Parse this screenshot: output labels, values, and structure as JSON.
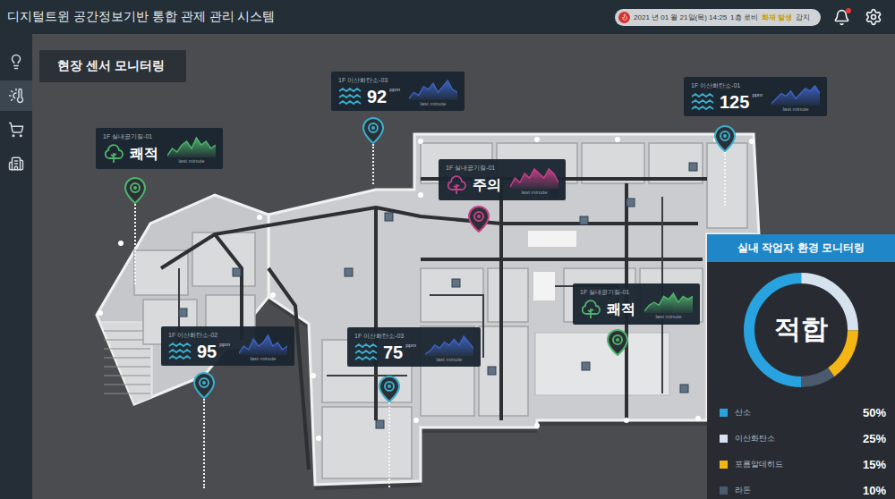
{
  "window": {
    "title": "디지털트윈 공간정보기반 통합 관제 관리 시스템"
  },
  "alert": {
    "date": "2021 년 01 월 21일(목) 14:25",
    "location": "1층 로비",
    "event": "화재 발생",
    "suffix": "감지"
  },
  "notifications": {
    "unread": true
  },
  "sidebar": {
    "items": [
      {
        "selected": false
      },
      {
        "selected": true
      },
      {
        "selected": false
      },
      {
        "selected": false
      }
    ]
  },
  "page": {
    "title": "현장 센서 모니터링"
  },
  "sensors": [
    {
      "kind": "air",
      "label": "1F 실내공기질-01",
      "status": "쾌적",
      "color": "#4fb36b",
      "caption": "last minute",
      "spark": [
        4,
        6,
        5,
        7,
        8,
        6,
        9,
        7,
        8,
        6,
        7
      ]
    },
    {
      "kind": "co2",
      "label": "1F 이산화탄소-03",
      "value": "92",
      "unit": "ppm",
      "color": "#3aaecb",
      "caption": "last minute",
      "spark": [
        3,
        5,
        4,
        7,
        6,
        8,
        5,
        7,
        9,
        6,
        5
      ]
    },
    {
      "kind": "co2",
      "label": "1F 이산화탄소-01",
      "value": "125",
      "unit": "ppm",
      "color": "#3aaecb",
      "caption": "last minute",
      "spark": [
        2,
        4,
        6,
        5,
        7,
        4,
        6,
        8,
        7,
        9,
        6
      ]
    },
    {
      "kind": "air",
      "label": "1F 실내공기질-01",
      "status": "주의",
      "color": "#c4408a",
      "caption": "last minute",
      "spark": [
        5,
        7,
        6,
        8,
        7,
        9,
        8,
        7,
        9,
        8,
        6
      ]
    },
    {
      "kind": "air",
      "label": "1F 실내공기질-01",
      "status": "쾌적",
      "color": "#4fb36b",
      "caption": "last minute",
      "spark": [
        3,
        5,
        6,
        5,
        8,
        7,
        9,
        6,
        8,
        7,
        8
      ]
    },
    {
      "kind": "co2",
      "label": "1F 이산화탄소-02",
      "value": "95",
      "unit": "ppm",
      "color": "#3aaecb",
      "caption": "last minute",
      "spark": [
        4,
        6,
        5,
        8,
        6,
        7,
        9,
        6,
        7,
        5,
        6
      ]
    },
    {
      "kind": "co2",
      "label": "1F 이산화탄소-03",
      "value": "75",
      "unit": "ppm",
      "color": "#3aaecb",
      "caption": "last minute",
      "spark": [
        3,
        4,
        6,
        5,
        7,
        6,
        8,
        6,
        9,
        7,
        5
      ]
    }
  ],
  "environment": {
    "title": "실내 작업자 환경 모니터링",
    "status": "적합",
    "series": [
      {
        "name": "산소",
        "value": 50,
        "reading": "50%",
        "color": "#29a3e0"
      },
      {
        "name": "이산화탄소",
        "value": 25,
        "reading": "25%",
        "color": "#d6e2ee"
      },
      {
        "name": "포름알데히드",
        "value": 15,
        "reading": "15%",
        "color": "#f3b614"
      },
      {
        "name": "라돈",
        "value": 10,
        "reading": "10%",
        "color": "#4b5a6c"
      }
    ]
  }
}
